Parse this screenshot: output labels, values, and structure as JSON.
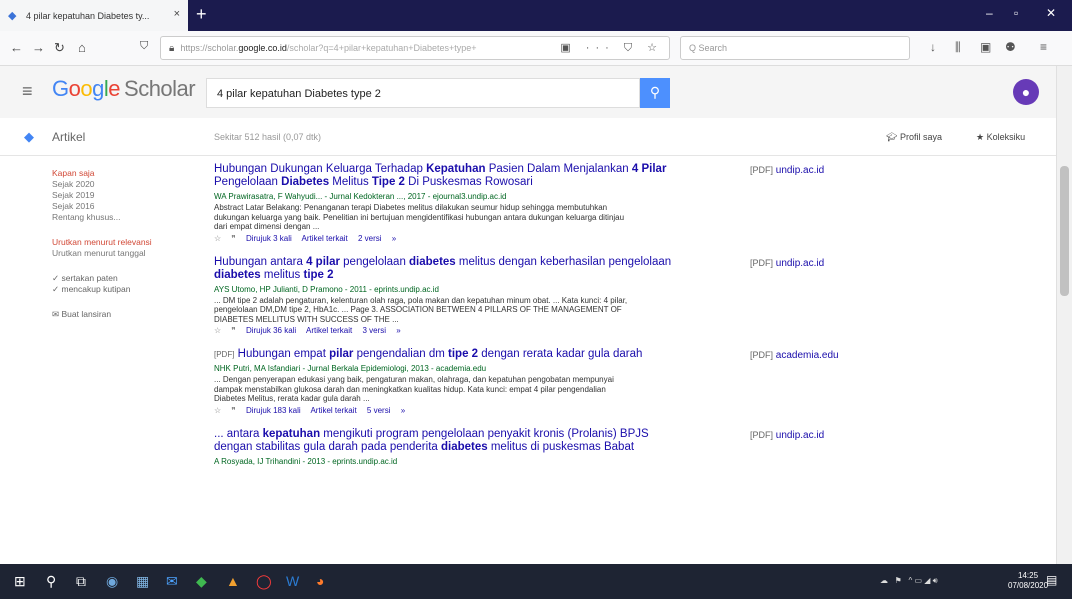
{
  "browser": {
    "tab_title": "4 pilar kepatuhan Diabetes ty...",
    "tab_close": "×",
    "new_tab": "+",
    "url_prefix": "https://scholar.",
    "url_domain": "google.co.id",
    "url_rest": "/scholar?q=4+pilar+kepatuhan+Diabetes+type+",
    "url_icons": "▣ ··· ⛉ ☆",
    "search_placeholder": "Q Search",
    "window_min": "–",
    "window_max": "▫",
    "window_close": "✕"
  },
  "scholar": {
    "logo_g": "G",
    "logo_o1": "o",
    "logo_o2": "o",
    "logo_g2": "g",
    "logo_l": "l",
    "logo_e": "e",
    "logo_scholar": "Scholar",
    "query": "4 pilar kepatuhan Diabetes type 2",
    "section": "Artikel",
    "results_info": "Sekitar 512 hasil (0,07 dtk)",
    "profile_link": "Profil saya",
    "library_link": "Koleksiku"
  },
  "sidebar": {
    "anytime": "Kapan saja",
    "y2020": "Sejak 2020",
    "y2019": "Sejak 2019",
    "y2016": "Sejak 2016",
    "custom": "Rentang khusus...",
    "sort_relevance": "Urutkan menurut relevansi",
    "sort_date": "Urutkan menurut tanggal",
    "include_patents": "sertakan paten",
    "include_citations": "mencakup kutipan",
    "create_alert": "Buat lansiran"
  },
  "results": [
    {
      "title_html_parts": [
        "Hubungan Dukungan Keluarga Terhadap ",
        "Kepatuhan",
        " Pasien Dalam Menjalankan ",
        "4 Pilar",
        " Pengelolaan ",
        "Diabetes",
        " Melitus ",
        "Tipe 2",
        " Di Puskesmas Rowosari"
      ],
      "source": "WA Prawirasatra, F Wahyudi... - Jurnal Kedokteran ..., 2017 - ejournal3.undip.ac.id",
      "snippet": "Abstract Latar Belakang: Penanganan terapi Diabetes melitus dilakukan seumur hidup sehingga membutuhkan dukungan keluarga yang baik. Penelitian ini bertujuan mengidentifikasi hubungan antara dukungan keluarga ditinjau dari empat dimensi dengan ...",
      "cited": "Dirujuk 3 kali",
      "related": "Artikel terkait",
      "versions": "2 versi",
      "pdf_tag": "[PDF]",
      "pdf_src": "undip.ac.id"
    },
    {
      "title_html_parts": [
        "Hubungan antara ",
        "4 pilar",
        " pengelolaan ",
        "diabetes",
        " melitus dengan keberhasilan pengelolaan ",
        "diabetes",
        " melitus ",
        "tipe 2",
        ""
      ],
      "source": "AYS Utomo, HP Julianti, D Pramono - 2011 - eprints.undip.ac.id",
      "snippet": "... DM tipe 2 adalah pengaturan, kelenturan olah raga, pola makan dan kepatuhan minum obat. ... Kata kunci: 4 pilar, pengelolaan DM,DM tipe 2, HbA1c. ... Page 3. ASSOCIATION BETWEEN 4 PILLARS OF THE MANAGEMENT OF DIABETES MELLITUS WITH SUCCESS OF THE ...",
      "cited": "Dirujuk 36 kali",
      "related": "Artikel terkait",
      "versions": "3 versi",
      "pdf_tag": "[PDF]",
      "pdf_src": "undip.ac.id"
    },
    {
      "prefix": "[PDF]",
      "title_html_parts": [
        "Hubungan empat ",
        "pilar",
        " pengendalian dm ",
        "tipe 2",
        " dengan rerata kadar gula darah",
        "",
        "",
        "",
        ""
      ],
      "source": "NHK Putri, MA Isfandiari - Jurnal Berkala Epidemiologi, 2013 - academia.edu",
      "snippet": "... Dengan penyerapan edukasi yang baik, pengaturan makan, olahraga, dan kepatuhan pengobatan mempunyai dampak menstabilkan glukosa darah dan meningkatkan kualitas hidup. Kata kunci: empat 4 pilar pengendalian Diabetes Melitus, rerata kadar gula darah ...",
      "cited": "Dirujuk 183 kali",
      "related": "Artikel terkait",
      "versions": "5 versi",
      "pdf_tag": "[PDF]",
      "pdf_src": "academia.edu"
    },
    {
      "title_html_parts": [
        "... antara ",
        "kepatuhan",
        " mengikuti program pengelolaan penyakit kronis (Prolanis) BPJS dengan stabilitas gula darah pada penderita ",
        "diabetes",
        " melitus di puskesmas Babat",
        "",
        "",
        "",
        ""
      ],
      "source": "A Rosyada, IJ Trihandini - 2013 - eprints.undip.ac.id",
      "snippet": "",
      "cited": "",
      "related": "",
      "versions": "",
      "pdf_tag": "[PDF]",
      "pdf_src": "undip.ac.id"
    }
  ],
  "taskbar": {
    "time": "14:25",
    "date": "07/08/2020"
  }
}
